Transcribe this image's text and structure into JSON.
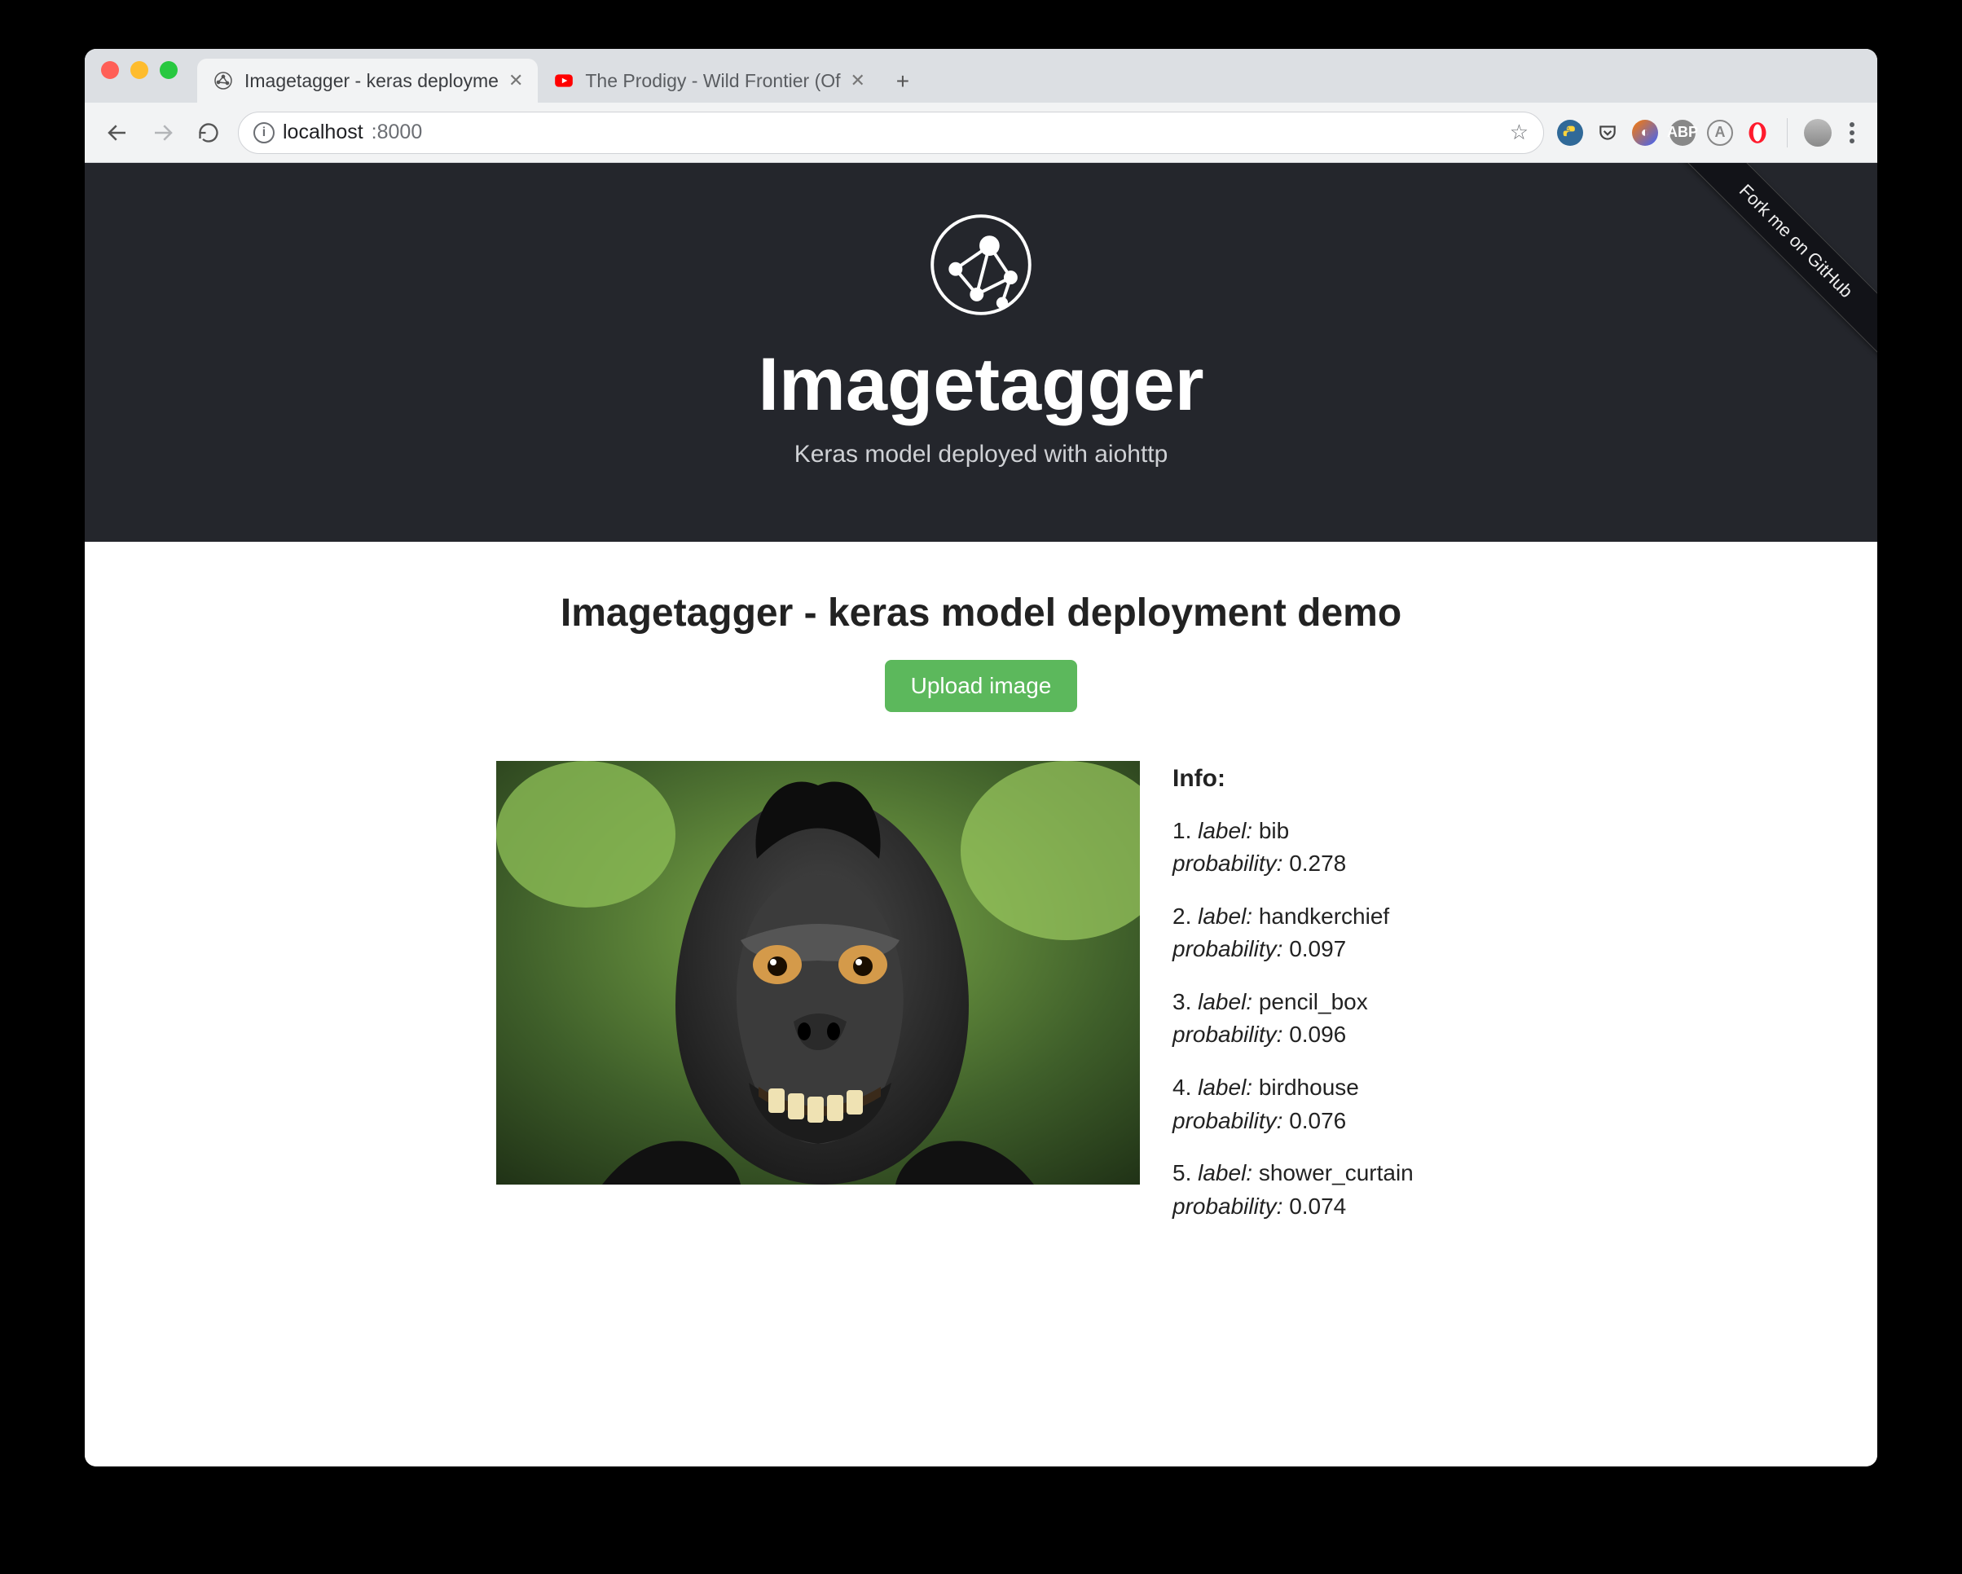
{
  "browser": {
    "tabs": [
      {
        "title": "Imagetagger - keras deployme",
        "favicon": "network",
        "active": true
      },
      {
        "title": "The Prodigy - Wild Frontier (Of",
        "favicon": "youtube",
        "active": false
      }
    ],
    "url_scheme_info": "i",
    "url_host": "localhost",
    "url_port": ":8000",
    "star_tooltip": "Bookmark this page"
  },
  "ribbon": {
    "label": "Fork me on GitHub"
  },
  "hero": {
    "title": "Imagetagger",
    "subtitle": "Keras model deployed with aiohttp"
  },
  "main": {
    "heading": "Imagetagger - keras model deployment demo",
    "upload_label": "Upload image"
  },
  "info": {
    "heading": "Info:",
    "label_key": "label:",
    "prob_key": "probability:",
    "predictions": [
      {
        "rank": "1.",
        "label": "bib",
        "probability": "0.278"
      },
      {
        "rank": "2.",
        "label": "handkerchief",
        "probability": "0.097"
      },
      {
        "rank": "3.",
        "label": "pencil_box",
        "probability": "0.096"
      },
      {
        "rank": "4.",
        "label": "birdhouse",
        "probability": "0.076"
      },
      {
        "rank": "5.",
        "label": "shower_curtain",
        "probability": "0.074"
      }
    ]
  }
}
